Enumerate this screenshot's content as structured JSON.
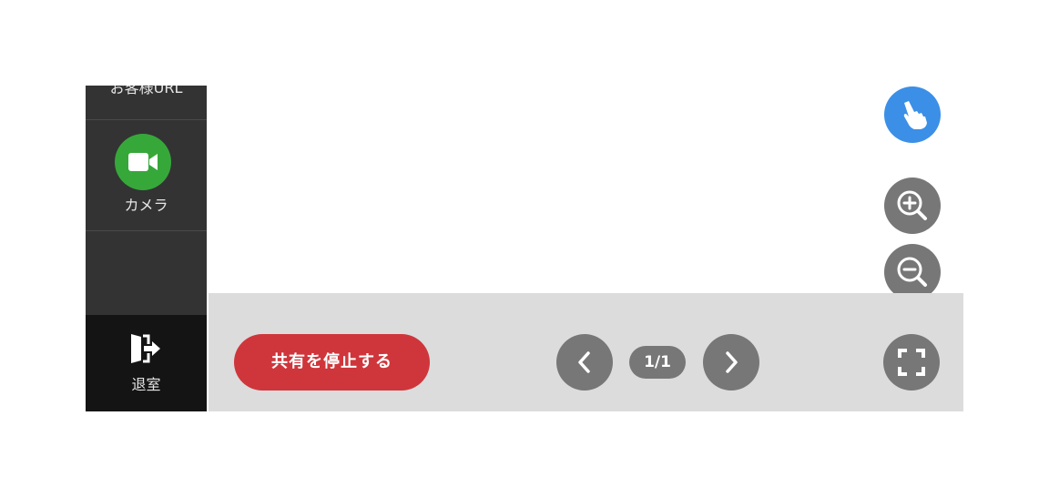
{
  "sidebar": {
    "url_label": "お客様URL",
    "camera_label": "カメラ",
    "exit_label": "退室",
    "camera_icon": "video-camera-icon",
    "exit_icon": "door-exit-icon"
  },
  "toolbar": {
    "stop_share_label": "共有を停止する",
    "page_indicator": "1/1",
    "prev_icon": "chevron-left-icon",
    "next_icon": "chevron-right-icon",
    "fullscreen_icon": "fullscreen-icon"
  },
  "controls": {
    "pointer_icon": "hand-pointer-icon",
    "zoom_in_icon": "zoom-in-icon",
    "zoom_out_icon": "zoom-out-icon"
  },
  "colors": {
    "sidebar_bg": "#333333",
    "exit_bg": "#141414",
    "camera_green": "#36a83a",
    "stop_red": "#cf363b",
    "pointer_blue": "#3b8fe6",
    "control_gray": "#777777",
    "toolbar_bg": "#dcdcdc"
  }
}
